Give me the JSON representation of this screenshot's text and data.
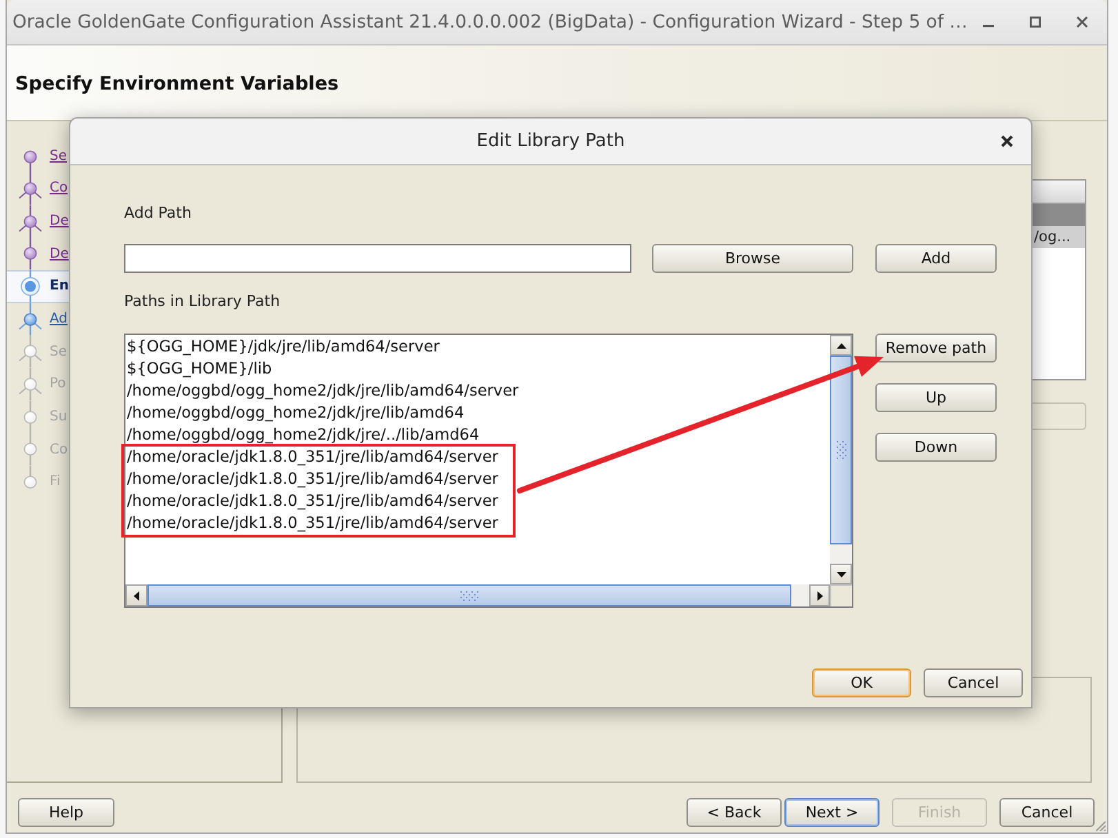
{
  "window": {
    "title": "Oracle GoldenGate Configuration Assistant 21.4.0.0.0.002 (BigData) - Configuration Wizard - Step 5 of …"
  },
  "header": {
    "title": "Specify Environment Variables"
  },
  "steps": [
    {
      "label": "Se",
      "kind": "visited",
      "selected": false,
      "branch": false
    },
    {
      "label": "Co",
      "kind": "visited",
      "selected": false,
      "branch": true
    },
    {
      "label": "De",
      "kind": "visited",
      "selected": false,
      "branch": true
    },
    {
      "label": "De",
      "kind": "visited",
      "selected": false,
      "branch": false
    },
    {
      "label": "En",
      "kind": "current",
      "selected": true,
      "branch": false
    },
    {
      "label": "Ad",
      "kind": "next",
      "selected": false,
      "branch": true
    },
    {
      "label": "Se",
      "kind": "pending",
      "selected": false,
      "branch": true
    },
    {
      "label": "Po",
      "kind": "pending",
      "selected": false,
      "branch": true
    },
    {
      "label": "Su",
      "kind": "pending",
      "selected": false,
      "branch": false
    },
    {
      "label": "Co",
      "kind": "pending",
      "selected": false,
      "branch": false
    },
    {
      "label": "Fi",
      "kind": "pending",
      "selected": false,
      "branch": false
    }
  ],
  "content": {
    "table": {
      "rows": [
        {
          "selected": true
        },
        {
          "text": "/og...",
          "selected": false
        }
      ]
    }
  },
  "help_button": {
    "label": "Help"
  },
  "nav_buttons": [
    {
      "label": "< Back",
      "focused": false,
      "disabled": false
    },
    {
      "label": "Next >",
      "focused": true,
      "disabled": false
    },
    {
      "label": "Finish",
      "focused": false,
      "disabled": true
    },
    {
      "label": "Cancel",
      "focused": false,
      "disabled": false
    }
  ],
  "dialog": {
    "title": "Edit Library Path",
    "add_path_label": "Add Path",
    "browse_button": "Browse",
    "add_button": "Add",
    "paths_label": "Paths in Library Path",
    "paths": [
      {
        "text": "${OGG_HOME}/jdk/jre/lib/amd64/server",
        "highlighted": false
      },
      {
        "text": "${OGG_HOME}/lib",
        "highlighted": false
      },
      {
        "text": "/home/oggbd/ogg_home2/jdk/jre/lib/amd64/server",
        "highlighted": false
      },
      {
        "text": "/home/oggbd/ogg_home2/jdk/jre/lib/amd64",
        "highlighted": false
      },
      {
        "text": "/home/oggbd/ogg_home2/jdk/jre/../lib/amd64",
        "highlighted": false
      },
      {
        "text": "/home/oracle/jdk1.8.0_351/jre/lib/amd64/server",
        "highlighted": true
      },
      {
        "text": "/home/oracle/jdk1.8.0_351/jre/lib/amd64/server",
        "highlighted": true
      },
      {
        "text": "/home/oracle/jdk1.8.0_351/jre/lib/amd64/server",
        "highlighted": true
      },
      {
        "text": "/home/oracle/jdk1.8.0_351/jre/lib/amd64/server",
        "highlighted": true
      }
    ],
    "side_buttons": [
      "Remove path",
      "Up",
      "Down"
    ],
    "buttons": [
      {
        "label": "OK",
        "default": true
      },
      {
        "label": "Cancel",
        "default": false
      }
    ]
  }
}
